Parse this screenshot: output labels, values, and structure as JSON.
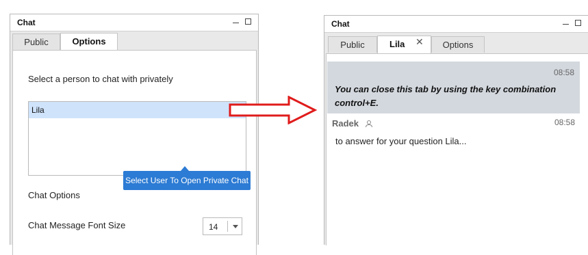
{
  "left": {
    "window_title": "Chat",
    "tabs": [
      {
        "label": "Public"
      },
      {
        "label": "Options"
      }
    ],
    "select_person_label": "Select a person to chat with privately",
    "user_list": [
      {
        "name": "Lila",
        "selected": true
      }
    ],
    "tooltip": "Select User To Open Private Chat",
    "chat_options_heading": "Chat Options",
    "font_size_label": "Chat Message Font Size",
    "font_size_value": "14"
  },
  "right": {
    "window_title": "Chat",
    "tabs": [
      {
        "label": "Public"
      },
      {
        "label": "Lila"
      },
      {
        "label": "Options"
      }
    ],
    "notice": {
      "time": "08:58",
      "text": "You can close this tab by using the key combination control+E."
    },
    "message": {
      "sender": "Radek",
      "time": "08:58",
      "text": "to answer for your question Lila..."
    }
  },
  "colors": {
    "selection": "#cfe3fb",
    "tooltip": "#2c7bd4",
    "notice_bg": "#d3d8de",
    "arrow": "#e01b1b"
  },
  "icons": [
    "minimize-icon",
    "maximize-icon",
    "close-tab-icon",
    "user-icon",
    "dropdown-arrow-icon"
  ]
}
